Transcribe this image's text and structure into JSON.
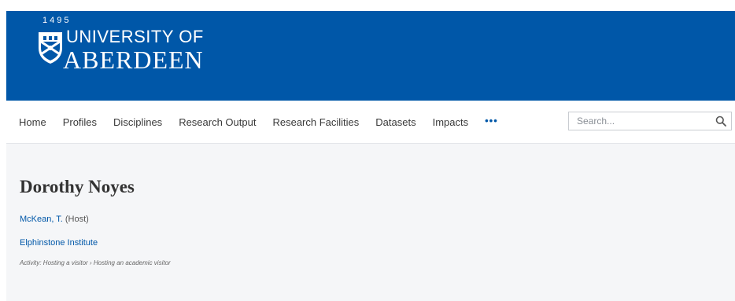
{
  "header": {
    "logo": {
      "year": "1495",
      "line1": "UNIVERSITY OF",
      "line2": "ABERDEEN"
    },
    "colors": {
      "brand": "#0057a8"
    }
  },
  "nav": {
    "items": [
      {
        "label": "Home"
      },
      {
        "label": "Profiles"
      },
      {
        "label": "Disciplines"
      },
      {
        "label": "Research Output"
      },
      {
        "label": "Research Facilities"
      },
      {
        "label": "Datasets"
      },
      {
        "label": "Impacts"
      }
    ],
    "more_label": "•••",
    "search": {
      "placeholder": "Search...",
      "value": "",
      "icon": "search-icon"
    }
  },
  "main": {
    "title": "Dorothy Noyes",
    "person": {
      "name": "McKean, T.",
      "role": "(Host)"
    },
    "organisation": "Elphinstone Institute",
    "activity": {
      "label": "Activity:",
      "type": "Hosting a visitor",
      "separator": "›",
      "subtype": "Hosting an academic visitor"
    }
  }
}
